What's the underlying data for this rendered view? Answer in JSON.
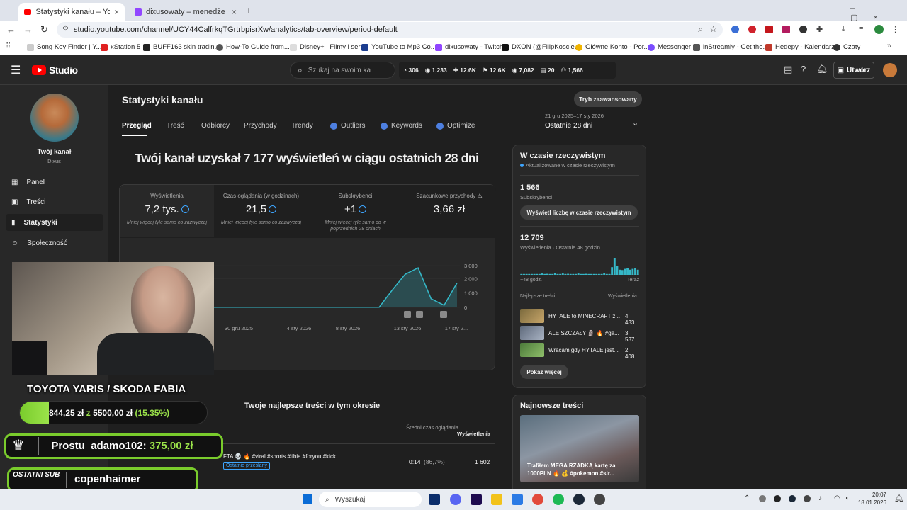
{
  "browser": {
    "tabs": [
      {
        "title": "Statystyki kanału – YouTube Stu"
      },
      {
        "title": "dixusowaty – menedżer klipów"
      }
    ],
    "url": "studio.youtube.com/channel/UCY44CalfrkqTGrtrbpisrXw/analytics/tab-overview/period-default",
    "bookmarks": [
      "Song Key Finder | Y...",
      "xStation 5",
      "BUFF163 skin tradin...",
      "How-To Guide from...",
      "Disney+ | Filmy i ser...",
      "YouTube to Mp3 Co...",
      "dixusowaty - Twitch",
      "DXON (@FilipKoscie...",
      "Główne Konto - Por...",
      "Messenger",
      "inStreamly - Get the...",
      "Hedepy - Kalendarz",
      "Czaty"
    ]
  },
  "studio": {
    "logo_text": "Studio",
    "search_placeholder": "Szukaj na swoim ka",
    "stats_bar": [
      "306",
      "1,233",
      "12.6K",
      "12.6K",
      "7,082",
      "20",
      "1,566"
    ],
    "create_label": "Utwórz"
  },
  "sidebar": {
    "channel_label": "Twój kanał",
    "channel_name": "Dixus",
    "items": [
      {
        "label": "Panel"
      },
      {
        "label": "Treści"
      },
      {
        "label": "Statystyki"
      },
      {
        "label": "Społeczność"
      }
    ]
  },
  "analytics": {
    "page_title": "Statystyki kanału",
    "advanced_mode": "Tryb zaawansowany",
    "tabs": [
      "Przegląd",
      "Treść",
      "Odbiorcy",
      "Przychody",
      "Trendy",
      "Outliers",
      "Keywords",
      "Optimize"
    ],
    "period_dates": "21 gru 2025–17 sty 2026",
    "period_label": "Ostatnie 28 dni",
    "headline": "Twój kanał uzyskał 7 177 wyświetleń w ciągu ostatnich 28 dni",
    "metrics": [
      {
        "label": "Wyświetlenia",
        "value": "7,2 tys.",
        "note": "Mniej więcej tyle samo co zazwyczaj"
      },
      {
        "label": "Czas oglądania (w godzinach)",
        "value": "21,5",
        "note": "Mniej więcej tyle samo co zazwyczaj"
      },
      {
        "label": "Subskrybenci",
        "value": "+1",
        "note": "Mniej więcej tyle samo co w poprzednich 28 dniach"
      },
      {
        "label": "Szacunkowe przychody",
        "value": "3,66 zł",
        "note": ""
      }
    ],
    "top_content_title": "Twoje najlepsze treści w tym okresie",
    "table_headers": {
      "avg_view": "Średni czas oglądania",
      "views": "Wyświetlenia"
    },
    "top_row": {
      "title": "FTA 💀 🔥 #viral #shorts #tibia #foryou #kick",
      "badge": "Ostatnio przesłany",
      "avg": "0:14",
      "pct": "(86,7%)",
      "views": "1 602"
    }
  },
  "chart_data": {
    "type": "area",
    "x_ticks": [
      "30 gru 2025",
      "4 sty 2026",
      "8 sty 2026",
      "13 sty 2026",
      "17 sty 2..."
    ],
    "y_ticks": [
      "3 000",
      "2 000",
      "1 000",
      "0"
    ],
    "ylim": [
      0,
      3200
    ],
    "values": [
      15,
      15,
      15,
      15,
      15,
      15,
      15,
      15,
      15,
      15,
      15,
      15,
      15,
      15,
      15,
      15,
      15,
      15,
      15,
      15,
      15,
      1200,
      2300,
      2750,
      600,
      150,
      1700
    ],
    "color": "#35b8c8"
  },
  "realtime": {
    "title": "W czasie rzeczywistym",
    "subtitle": "Aktualizowane w czasie rzeczywistym",
    "subs_value": "1 566",
    "subs_label": "Subskrybenci",
    "subs_button": "Wyświetl liczbę w czasie rzeczywistym",
    "views_value": "12 709",
    "views_label": "Wyświetlenia · Ostatnie 48 godzin",
    "axis_start": "−48 godz.",
    "axis_end": "Teraz",
    "top_label": "Najlepsze treści",
    "views_col": "Wyświetlenia",
    "items": [
      {
        "title": "HYTALE to MINECRAFT z...",
        "views": "4 433"
      },
      {
        "title": "ALE SZCZAŁY 🗿 🔥 #ga...",
        "views": "3 537"
      },
      {
        "title": "Wracam gdy HYTALE jest...",
        "views": "2 408"
      }
    ],
    "more_button": "Pokaż więcej",
    "bars": [
      0.05,
      0.05,
      0.05,
      0.05,
      0.05,
      0.05,
      0.05,
      0.05,
      0.08,
      0.05,
      0.06,
      0.05,
      0.05,
      0.1,
      0.05,
      0.05,
      0.08,
      0.05,
      0.06,
      0.05,
      0.05,
      0.05,
      0.08,
      0.05,
      0.05,
      0.06,
      0.05,
      0.05,
      0.05,
      0.05,
      0.05,
      0.05,
      0.12,
      0.05,
      0.05,
      0.45,
      1.0,
      0.5,
      0.3,
      0.28,
      0.35,
      0.4,
      0.3,
      0.35,
      0.38,
      0.3
    ]
  },
  "newest": {
    "title": "Najnowsze treści",
    "video_caption": "Trafiłem MEGA RZADKĄ kartę za 1000PLN 🔥 💰 #pokemon #sir..."
  },
  "overlays": {
    "goal_title": "TOYOTA YARIS / SKODA FABIA",
    "goal_current": "844,25 zł",
    "goal_z": "z",
    "goal_target": "5500,00 zł",
    "goal_pct": "(15.35%)",
    "donor_name": "_Prostu_adamo102:",
    "donor_amount": "375,00 zł",
    "last_sub_label": "OSTATNI SUB",
    "last_sub_name": "copenhaimer"
  },
  "taskbar": {
    "search": "Wyszukaj",
    "time": "20:07",
    "date": "18.01.2026"
  }
}
